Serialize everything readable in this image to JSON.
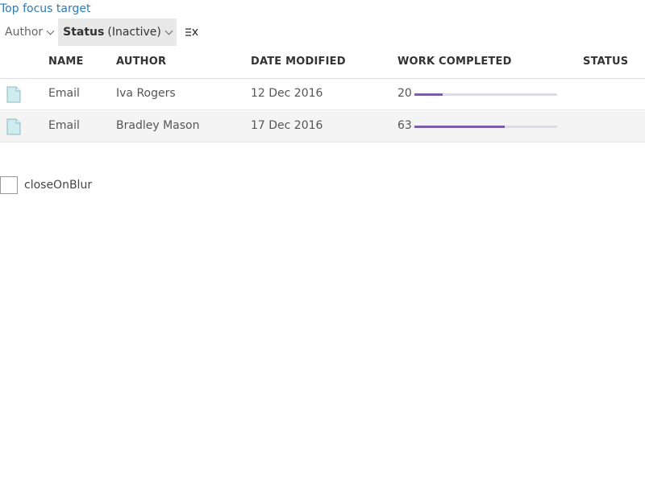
{
  "top_link": "Top focus target",
  "filters": {
    "author_label": "Author",
    "status_label": "Status",
    "status_value": "(Inactive)",
    "clear_icon": "clear-filter-icon"
  },
  "table": {
    "columns": [
      "NAME",
      "AUTHOR",
      "DATE MODIFIED",
      "WORK COMPLETED",
      "STATUS"
    ],
    "rows": [
      {
        "name": "Email",
        "author": "Iva Rogers",
        "date": "12 Dec 2016",
        "work": "20",
        "work_fraction": 0.2,
        "status": ""
      },
      {
        "name": "Email",
        "author": "Bradley Mason",
        "date": "17 Dec 2016",
        "work": "63",
        "work_fraction": 0.63,
        "status": ""
      }
    ]
  },
  "checkbox": {
    "label": "closeOnBlur",
    "checked": false
  },
  "colors": {
    "link": "#2e7ab8",
    "progress": "#7a5ea8",
    "progress_track": "#dcdce4"
  }
}
